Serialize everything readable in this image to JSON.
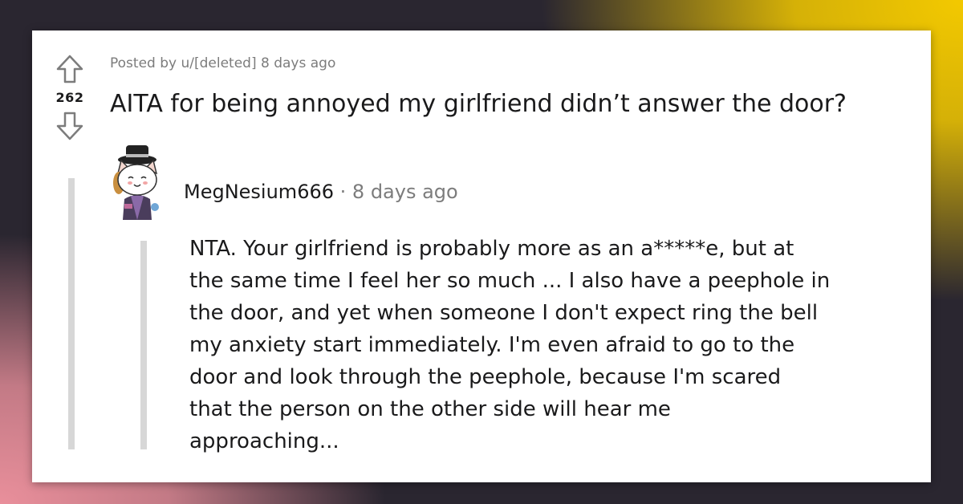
{
  "post": {
    "score": "262",
    "meta": "Posted by u/[deleted] 8 days ago",
    "title": "AITA for being annoyed my girlfriend didn’t answer the door?"
  },
  "comment": {
    "author": "MegNesium666",
    "separator": "·",
    "time": "8 days ago",
    "lines": [
      "NTA. Your girlfriend is probably more as an a*****e, but at",
      "the same time I feel her so much ... I also have a peephole in",
      "the door, and yet when someone I don't expect ring the bell",
      "my anxiety start immediately. I'm even afraid to go to the",
      "door and look through the peephole, because I'm scared",
      "that the person on the other side will hear me",
      "approaching..."
    ]
  },
  "icons": {
    "upvote": "upvote-arrow-icon",
    "downvote": "downvote-arrow-icon",
    "avatar": "snoo-avatar-icon"
  },
  "colors": {
    "text": "#1a1a1b",
    "muted": "#7c7c7c",
    "thread_line": "#d7d7d7"
  }
}
